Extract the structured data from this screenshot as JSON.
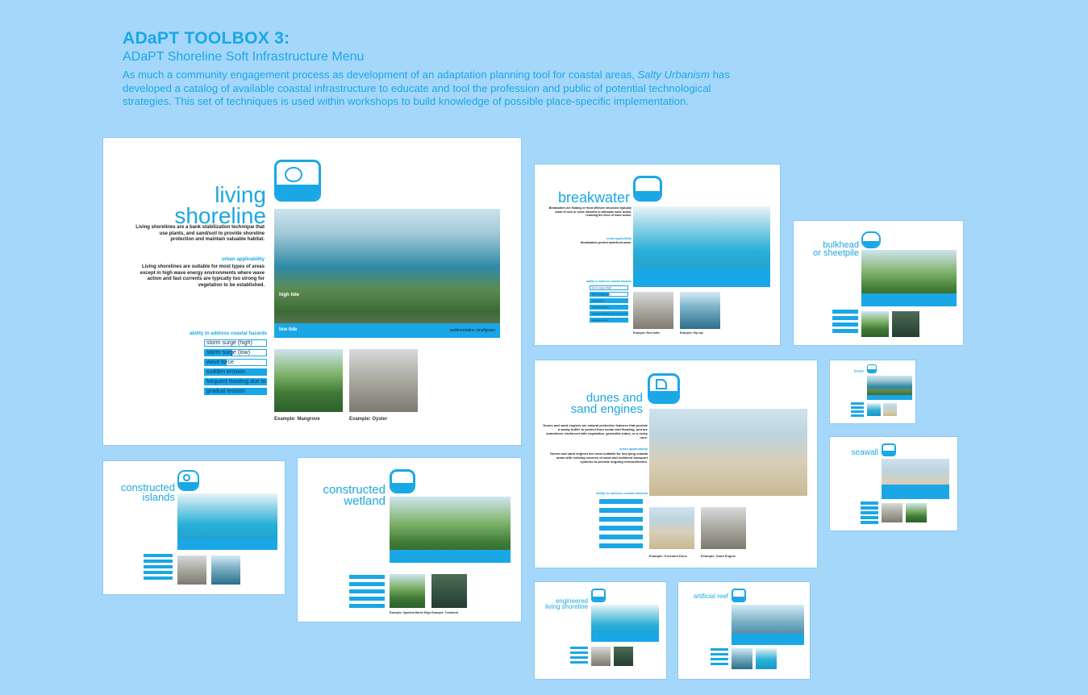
{
  "header": {
    "title": "ADaPT TOOLBOX 3:",
    "subtitle": "ADaPT Shoreline Soft Infrastructure Menu",
    "desc_1": "As much a community engagement process as development of an adaptation planning tool for coastal areas,",
    "desc_italic": "Salty Urbanism",
    "desc_2": " has developed a catalog of available coastal infrastructure to educate and tool the profession and public of potential technological strategies. This set of techniques is used within workshops to build knowledge of possible place-specific implementation."
  },
  "living": {
    "title_1": "living",
    "title_2": "shoreline",
    "intro": "Living shorelines are a bank stabilization technique that use plants, and sand/soil to provide shoreline protection and maintain valuable habitat.",
    "applicability_label": "urban applicability",
    "applicability_text": "Living shorelines are suitable for most types of areas except in high wave energy environments where wave action and fast currents are typically too strong for vegetation to be established.",
    "hazards_label": "ability to address coastal hazards",
    "hazards": [
      {
        "label": "storm surge (high)",
        "level": 0.0
      },
      {
        "label": "storm surge (low)",
        "level": 0.45
      },
      {
        "label": "wave force",
        "level": 0.35
      },
      {
        "label": "sudden erosion",
        "level": 1.0
      },
      {
        "label": "frequent flooding due to sea level rise",
        "level": 1.0
      },
      {
        "label": "gradual erosion",
        "level": 1.0
      }
    ],
    "high_tide": "high tide",
    "low_tide": "low tide",
    "sediment": "sedimentation smallgrass",
    "caption_1": "Example: Mangrove",
    "caption_2": "Example: Oyster"
  },
  "breakwater": {
    "title": "breakwater",
    "intro": "Breakwaters are floating or fixed offshore structures typically made of rock or stone intended to attenuate wave action, reducing the force of wave action.",
    "applicability_label": "urban applicability",
    "applicability_text": "Breakwaters protect waterfront areas.",
    "hazards_label": "ability to address coastal hazards",
    "hazards": [
      "storm surge (high)",
      "storm surge (low)",
      "wave force",
      "sudden erosion",
      "frequent flooding due to sea level rise",
      "gradual erosion"
    ],
    "caption_1": "Example: Reef balls",
    "caption_2": "Example: Rip rap"
  },
  "bulkhead": {
    "title_1": "bulkhead",
    "title_2": "or sheetpile"
  },
  "dunes": {
    "title_1": "dunes and",
    "title_2": "sand engines",
    "intro": "Dunes and sand engines are natural protective features that provide a sandy buffer to protect from ocean and flooding, and are sometimes reinforced with vegetation, geotextile tubes, or a rocky core.",
    "applicability_label": "urban applicability",
    "applicability_text": "Dunes and sand engines are most suitable for low-lying coastal areas with existing sources of sand and sediment transport systems to provide ongoing renourishment.",
    "hazards_label": "ability to address coastal hazards",
    "caption_1": "Example: Forested Dune",
    "caption_2": "Example: Sand Engine"
  },
  "islands": {
    "title_1": "constructed",
    "title_2": "islands"
  },
  "wetland": {
    "title_1": "constructed",
    "title_2": "wetland",
    "caption_1": "Example: Spartina Marsh Edge",
    "caption_2": "Example: Treatment"
  },
  "levee": {
    "title": "levee"
  },
  "seawall": {
    "title": "seawall"
  },
  "engineered": {
    "title_1": "engineered",
    "title_2": "living shoreline"
  },
  "reef": {
    "title": "artificial reef"
  }
}
